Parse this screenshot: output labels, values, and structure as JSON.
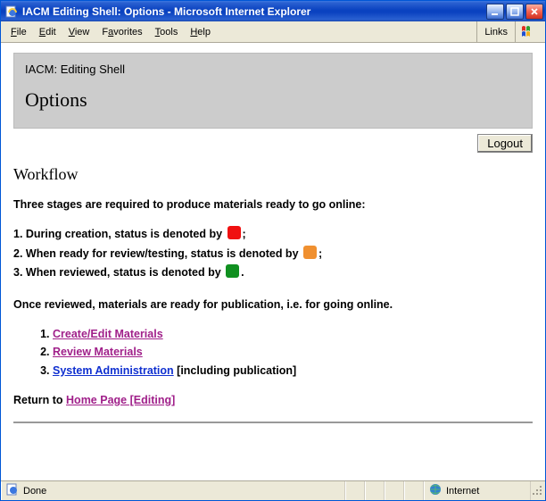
{
  "window": {
    "title": "IACM Editing Shell: Options - Microsoft Internet Explorer"
  },
  "menu": {
    "items": [
      "File",
      "Edit",
      "View",
      "Favorites",
      "Tools",
      "Help"
    ],
    "links_label": "Links"
  },
  "banner": {
    "subtitle": "IACM: Editing Shell",
    "title": "Options"
  },
  "logout_label": "Logout",
  "workflow": {
    "heading": "Workflow",
    "intro": "Three stages are required to produce materials ready to go online:",
    "stages": [
      {
        "prefix": "1. During creation, status is denoted by ",
        "color": "#f01010",
        "suffix": ";"
      },
      {
        "prefix": "2. When ready for review/testing, status is denoted by ",
        "color": "#f09030",
        "suffix": ";"
      },
      {
        "prefix": "3. When reviewed, status is denoted by ",
        "color": "#109020",
        "suffix": "."
      }
    ],
    "after": "Once reviewed, materials are ready for publication, i.e. for going online."
  },
  "links": [
    {
      "label": "Create/Edit Materials",
      "visited": true,
      "extra": ""
    },
    {
      "label": "Review Materials",
      "visited": true,
      "extra": ""
    },
    {
      "label": "System Administration",
      "visited": false,
      "extra": " [including publication]"
    }
  ],
  "return_text": "Return to ",
  "return_link": "Home Page [Editing]",
  "status": {
    "done": "Done",
    "zone": "Internet"
  }
}
